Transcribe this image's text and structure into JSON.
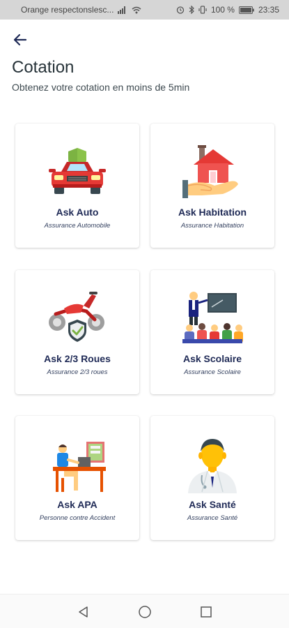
{
  "status_bar": {
    "carrier": "Orange respectonslesc...",
    "battery": "100 %",
    "time": "23:35"
  },
  "header": {
    "title": "Cotation",
    "subtitle": "Obtenez votre cotation en moins de 5min"
  },
  "cards": [
    {
      "title": "Ask Auto",
      "subtitle": "Assurance Automobile",
      "icon": "car-shield-icon"
    },
    {
      "title": "Ask Habitation",
      "subtitle": "Assurance Habitation",
      "icon": "house-hand-icon"
    },
    {
      "title": "Ask 2/3 Roues",
      "subtitle": "Assurance 2/3 roues",
      "icon": "motorbike-shield-icon"
    },
    {
      "title": "Ask Scolaire",
      "subtitle": "Assurance Scolaire",
      "icon": "classroom-icon"
    },
    {
      "title": "Ask APA",
      "subtitle": "Personne contre Accident",
      "icon": "person-desk-icon"
    },
    {
      "title": "Ask Santé",
      "subtitle": "Assurance Santé",
      "icon": "doctor-icon"
    }
  ],
  "colors": {
    "title_text": "#1f2a56",
    "accent_red": "#e53935",
    "shield_green": "#7cb342"
  }
}
